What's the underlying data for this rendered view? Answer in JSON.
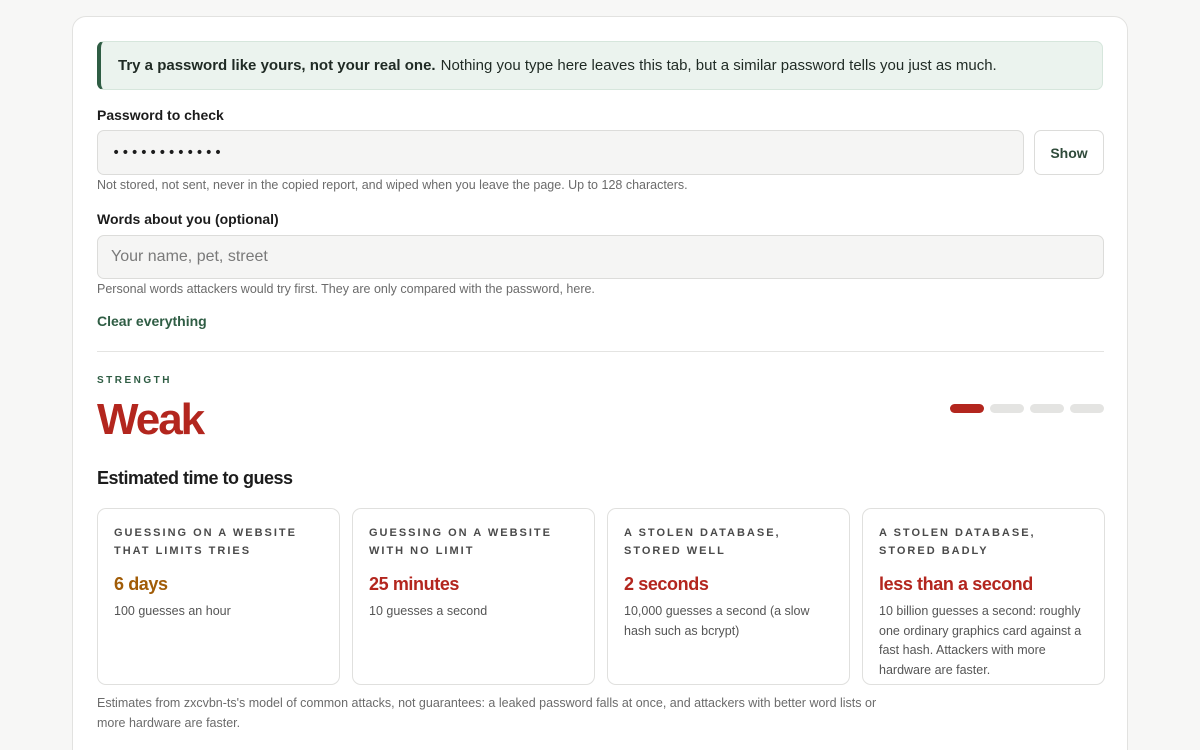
{
  "notice": {
    "bold": "Try a password like yours, not your real one.",
    "text": "Nothing you type here leaves this tab, but a similar password tells you just as much."
  },
  "password": {
    "label": "Password to check",
    "value": "••••••••••••",
    "show_label": "Show",
    "hint": "Not stored, not sent, never in the copied report, and wiped when you leave the page. Up to 128 characters."
  },
  "words": {
    "label": "Words about you (optional)",
    "placeholder": "Your name, pet, street",
    "hint": "Personal words attackers would try first. They are only compared with the password, here."
  },
  "clear_label": "Clear everything",
  "strength": {
    "eyebrow": "STRENGTH",
    "word": "Weak",
    "color": "#b3261e",
    "meter_filled": 1,
    "meter_total": 4
  },
  "estimates": {
    "title": "Estimated time to guess",
    "scenarios": [
      {
        "title": "Guessing on a website that limits tries",
        "time": "6 days",
        "time_color": "#a15c07",
        "desc": "100 guesses an hour"
      },
      {
        "title": "Guessing on a website with no limit",
        "time": "25 minutes",
        "time_color": "#b3261e",
        "desc": "10 guesses a second"
      },
      {
        "title": "A stolen database, stored well",
        "time": "2 seconds",
        "time_color": "#b3261e",
        "desc": "10,000 guesses a second (a slow hash such as bcrypt)"
      },
      {
        "title": "A stolen database, stored badly",
        "time": "less than a second",
        "time_color": "#b3261e",
        "desc": "10 billion guesses a second: roughly one ordinary graphics card against a fast hash. Attackers with more hardware are faster."
      }
    ],
    "footnote": "Estimates from zxcvbn-ts's model of common attacks, not guarantees: a leaked password falls at once, and attackers with better word lists or more hardware are faster."
  }
}
